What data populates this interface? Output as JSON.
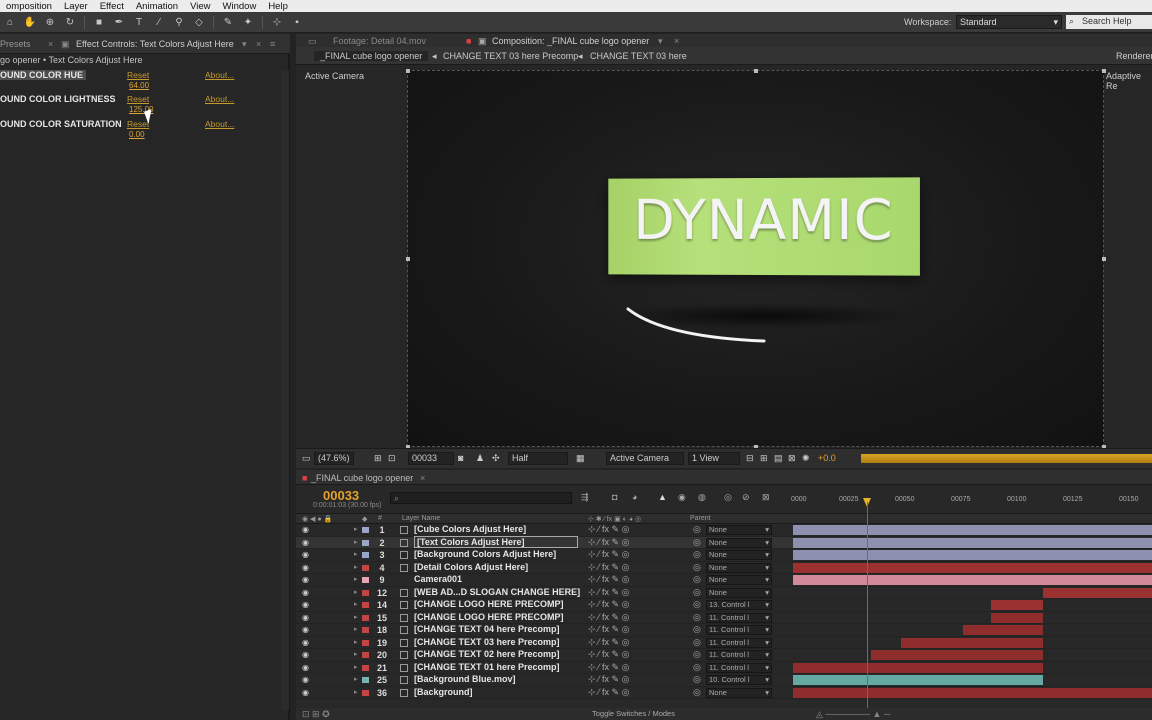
{
  "menu": [
    "omposition",
    "Layer",
    "Effect",
    "Animation",
    "View",
    "Window",
    "Help"
  ],
  "workspace": {
    "label": "Workspace:",
    "value": "Standard",
    "search": "Search Help"
  },
  "left": {
    "tab_presets": "Presets",
    "tab_effect_controls": "Effect Controls: Text Colors Adjust Here",
    "breadcrumb": "go opener • Text Colors Adjust Here",
    "effects": [
      {
        "name": "OUND COLOR HUE",
        "reset": "Reset",
        "about": "About...",
        "value": "64.00"
      },
      {
        "name": "OUND COLOR LIGHTNESS",
        "reset": "Reset",
        "about": "About...",
        "value": "125.00"
      },
      {
        "name": "OUND COLOR SATURATION",
        "reset": "Reset",
        "about": "About...",
        "value": "0.00"
      }
    ]
  },
  "comp": {
    "tab_footage": "Footage: Detail 04.mov",
    "tab_composition": "Composition: _FINAL cube logo opener",
    "sub_tabs": [
      "_FINAL cube logo opener",
      "CHANGE TEXT 03 here Precomp",
      "CHANGE TEXT 03 here"
    ],
    "renderer": "Renderer",
    "active_camera": "Active Camera",
    "adaptive": "Adaptive Re",
    "logo_text": "DYNAMIC",
    "zoom": "(47.6%)",
    "timecode": "00033",
    "resolution": "Half",
    "view_camera": "Active Camera",
    "view_count": "1 View",
    "exposure": "+0.0"
  },
  "timeline": {
    "title": "_FINAL cube logo opener",
    "time": "00033",
    "fps": "0:00:01:03 (30.00 fps)",
    "ruler": [
      "0000",
      "00025",
      "00050",
      "00075",
      "00100",
      "00125",
      "00150"
    ],
    "col_layer_name": "Layer Name",
    "col_parent": "Parent",
    "col_num": "#",
    "footer": "Toggle Switches / Modes",
    "layers": [
      {
        "num": "1",
        "name": "[Cube Colors Adjust Here]",
        "color": "#9aa6c8",
        "parent": "None"
      },
      {
        "num": "2",
        "name": "[Text Colors Adjust Here]",
        "color": "#9aa6c8",
        "parent": "None"
      },
      {
        "num": "3",
        "name": "[Background Colors Adjust Here]",
        "color": "#9aa6c8",
        "parent": "None"
      },
      {
        "num": "4",
        "name": "[Detail Colors Adjust Here]",
        "color": "#c24545",
        "parent": "None"
      },
      {
        "num": "9",
        "name": "Camera001",
        "color": "#e8a3b4",
        "parent": "None"
      },
      {
        "num": "12",
        "name": "[WEB AD...D SLOGAN CHANGE HERE]",
        "color": "#c24545",
        "parent": "None"
      },
      {
        "num": "14",
        "name": "[CHANGE LOGO HERE PRECOMP]",
        "color": "#c24545",
        "parent": "13. Control l"
      },
      {
        "num": "15",
        "name": "[CHANGE LOGO HERE PRECOMP]",
        "color": "#c24545",
        "parent": "11. Control l"
      },
      {
        "num": "18",
        "name": "[CHANGE TEXT 04 here Precomp]",
        "color": "#c24545",
        "parent": "11. Control l"
      },
      {
        "num": "19",
        "name": "[CHANGE TEXT 03 here Precomp]",
        "color": "#c24545",
        "parent": "11. Control l"
      },
      {
        "num": "20",
        "name": "[CHANGE TEXT 02 here Precomp]",
        "color": "#c24545",
        "parent": "11. Control l"
      },
      {
        "num": "21",
        "name": "[CHANGE TEXT 01 here Precomp]",
        "color": "#c24545",
        "parent": "11. Control l"
      },
      {
        "num": "25",
        "name": "[Background Blue.mov]",
        "color": "#6fb7b0",
        "parent": "10. Control l"
      },
      {
        "num": "36",
        "name": "[Background]",
        "color": "#c24545",
        "parent": "None"
      }
    ]
  }
}
